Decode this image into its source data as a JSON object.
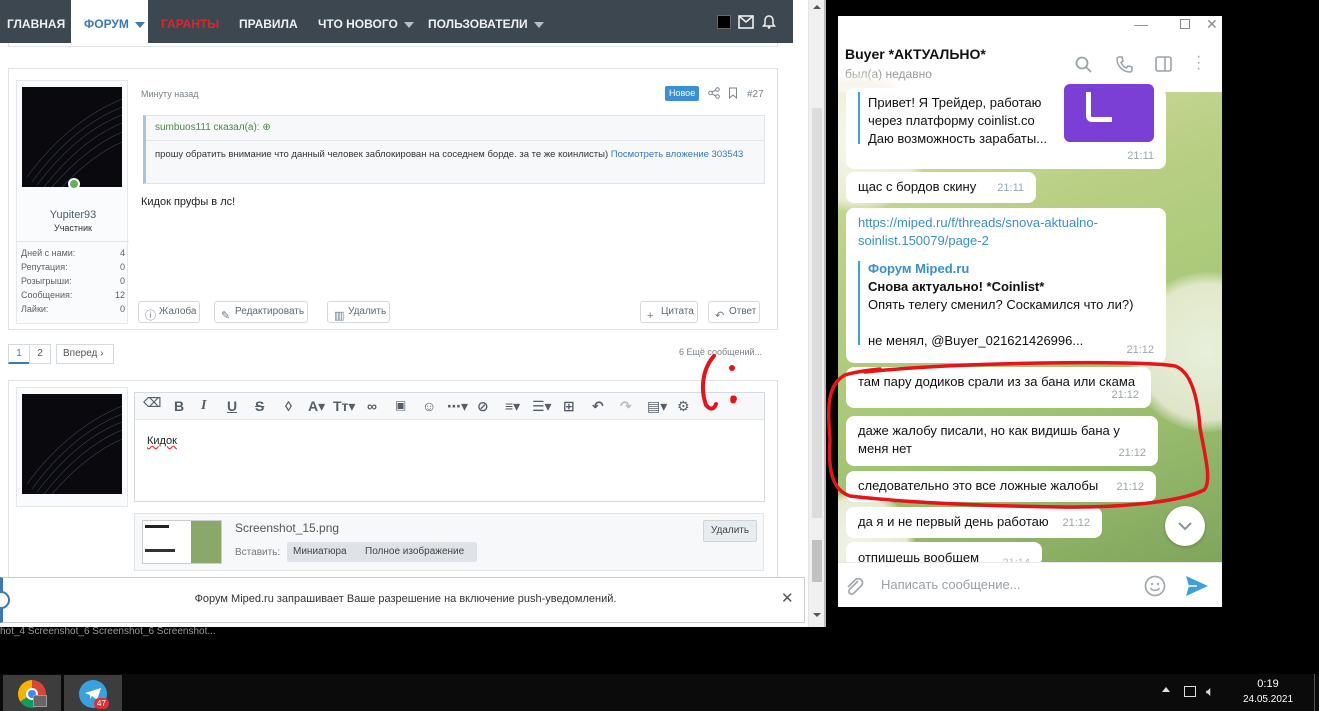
{
  "forum": {
    "nav": {
      "home": "ГЛАВНАЯ",
      "forum": "ФОРУМ",
      "guarantors": "ГАРАНТЫ",
      "rules": "ПРАВИЛА",
      "whats_new": "ЧТО НОВОГО",
      "users": "ПОЛЬЗОВАТЕЛИ"
    },
    "post": {
      "time": "Минуту назад",
      "badge": "Новое",
      "number": "#27",
      "author": "Yupiter93",
      "role": "Участник",
      "stats": [
        {
          "label": "Дней с нами:",
          "value": "4"
        },
        {
          "label": "Репутация:",
          "value": "0"
        },
        {
          "label": "Розыгрыши:",
          "value": "0"
        },
        {
          "label": "Сообщения:",
          "value": "12"
        },
        {
          "label": "Лайки:",
          "value": "0"
        }
      ],
      "quote_header": "sumbuos111 сказал(а):",
      "quote_text": "прошу обратить внимание что данный человек заблокирован на соседнем борде. за те же коинлисты)",
      "quote_link": "Посмотреть вложение 303543",
      "body": "Кидок пруфы в лс!",
      "actions": {
        "report": "Жалоба",
        "edit": "Редактировать",
        "delete": "Удалить",
        "quote": "Цитата",
        "reply": "Ответ"
      }
    },
    "pagination": {
      "page1": "1",
      "page2": "2",
      "next": "Вперед",
      "more": "6 Ещё сообщений..."
    },
    "editor": {
      "text": "Кидок",
      "attachment_name": "Screenshot_15.png",
      "insert_label": "Вставить:",
      "thumbnail": "Миниатюра",
      "full_image": "Полное изображение",
      "delete": "Удалить"
    },
    "push_notice": "Форум Miped.ru запрашивает Ваше разрешение на включение push-уведомлений."
  },
  "desktop_strip": "hot_4  Screenshot_6  Screenshot_6  Screenshot...",
  "telegram": {
    "title": "Buyer *АКТУАЛЬНО*",
    "status": "был(а) недавно",
    "messages": [
      {
        "lines": [
          "Привет! Я Трейдер, работаю",
          "через платформу coinlist.co",
          "Даю возможность зарабаты..."
        ],
        "time": "21:11"
      },
      {
        "lines": [
          "щас  с бордов скину"
        ],
        "time": "21:11"
      },
      {
        "lines": [
          "https://miped.ru/f/threads/snova-aktualno-",
          "soinlist.150079/page-2"
        ],
        "time": "21:12",
        "preview": {
          "site": "Форум Miped.ru",
          "title": "Снова актуально! *Coinlist*",
          "text": "Опять телегу сменил? Соскамился что ли?)",
          "text2": "не менял, @Buyer_021621426996..."
        }
      },
      {
        "lines": [
          "там пару додиков срали из за бана или скама"
        ],
        "time": "21:12"
      },
      {
        "lines": [
          "даже жалобу писали, но как видишь бана у",
          "меня нет"
        ],
        "time": "21:12"
      },
      {
        "lines": [
          "следовательно это все ложные жалобы"
        ],
        "time": "21:12"
      },
      {
        "lines": [
          "да я и не первый день работаю"
        ],
        "time": "21:12"
      },
      {
        "lines": [
          "отпишешь вообщем"
        ],
        "time": "21:14"
      }
    ],
    "input_placeholder": "Написать сообщение..."
  },
  "taskbar": {
    "time": "0:19",
    "date": "24.05.2021",
    "telegram_badge": "47"
  },
  "colors": {
    "forum_nav_bg": "#3d4750",
    "forum_accent": "#3a78b8",
    "annotation_red": "#e8121b",
    "telegram_accent": "#3aa1e0"
  }
}
